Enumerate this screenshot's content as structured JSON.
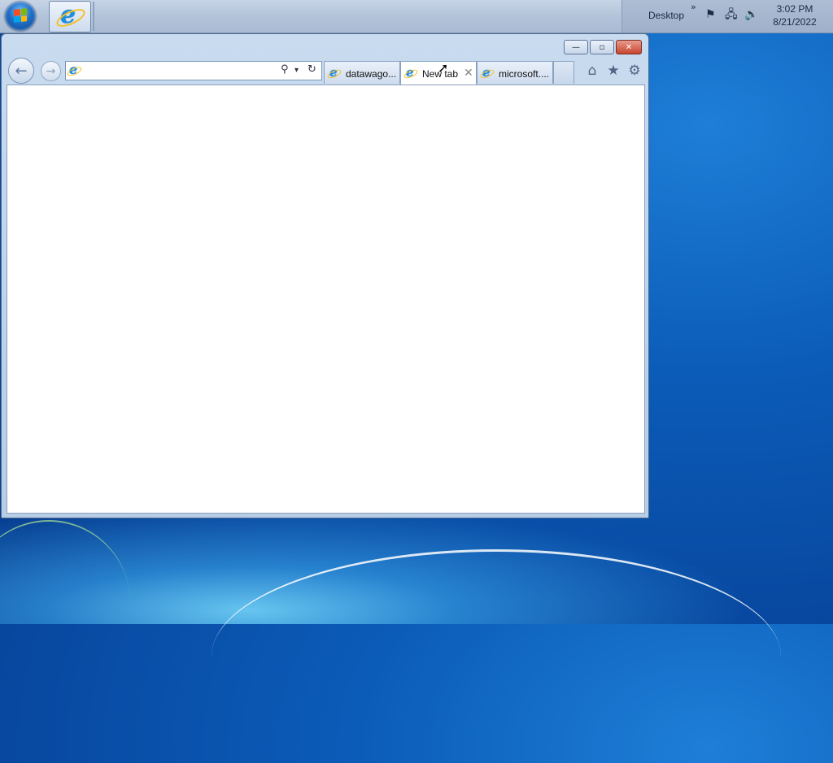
{
  "taskbar": {
    "start_icon": "windows-start-orb",
    "pinned": [
      {
        "name": "internet-explorer",
        "icon": "ie-icon"
      }
    ],
    "tray": {
      "desktop_label": "Desktop",
      "chevron": "»",
      "icons": [
        "flag-icon",
        "network-icon",
        "volume-icon"
      ],
      "time": "3:02 PM",
      "date": "8/21/2022"
    }
  },
  "browser": {
    "window_buttons": {
      "minimize": "—",
      "maximize": "▫",
      "close": "✕"
    },
    "nav": {
      "back": "←",
      "forward": "→"
    },
    "address": {
      "value": "",
      "search_icon": "⚲",
      "dropdown_icon": "▾",
      "refresh_icon": "↻"
    },
    "tabs": [
      {
        "label": "datawago...",
        "active": false
      },
      {
        "label": "New tab",
        "active": true,
        "close": "✕"
      },
      {
        "label": "microsoft....",
        "active": false
      }
    ],
    "commands": {
      "home": "⌂",
      "favorites": "★",
      "tools": "⚙"
    }
  },
  "colors": {
    "accent": "#1b8fe0",
    "close": "#c8452f",
    "desktop": "#0b5cb8"
  }
}
